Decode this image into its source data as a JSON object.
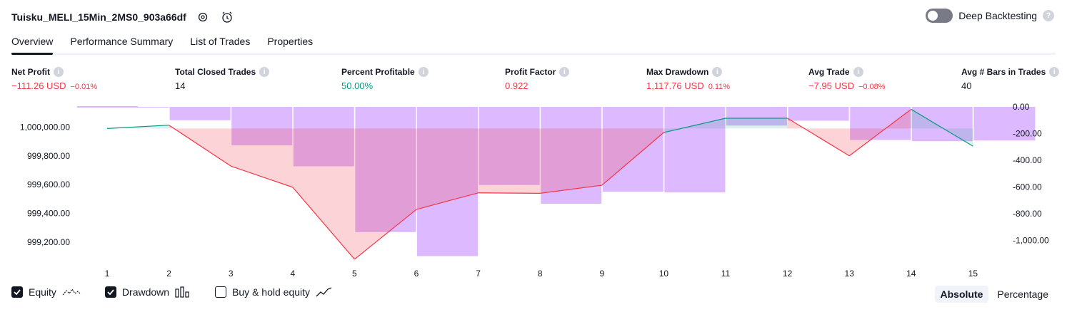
{
  "header": {
    "title": "Tuisku_MELI_15Min_2MS0_903a66df",
    "deep_backtesting_label": "Deep Backtesting"
  },
  "tabs": [
    {
      "label": "Overview",
      "active": true
    },
    {
      "label": "Performance Summary",
      "active": false
    },
    {
      "label": "List of Trades",
      "active": false
    },
    {
      "label": "Properties",
      "active": false
    }
  ],
  "metrics": {
    "net_profit": {
      "label": "Net Profit",
      "value": "−111.26 USD",
      "pct": "−0.01%"
    },
    "total_closed_trades": {
      "label": "Total Closed Trades",
      "value": "14"
    },
    "percent_profitable": {
      "label": "Percent Profitable",
      "value": "50.00%"
    },
    "profit_factor": {
      "label": "Profit Factor",
      "value": "0.922"
    },
    "max_drawdown": {
      "label": "Max Drawdown",
      "value": "1,117.76 USD",
      "pct": "0.11%"
    },
    "avg_trade": {
      "label": "Avg Trade",
      "value": "−7.95 USD",
      "pct": "−0.08%"
    },
    "avg_bars": {
      "label": "Avg # Bars in Trades",
      "value": "40"
    }
  },
  "chart_data": {
    "type": "line",
    "x": [
      1,
      2,
      3,
      4,
      5,
      6,
      7,
      8,
      9,
      10,
      11,
      12,
      13,
      14,
      15
    ],
    "left_axis_ticks": [
      "1,000,000.00",
      "999,800.00",
      "999,600.00",
      "999,400.00",
      "999,200.00"
    ],
    "left_axis_values": [
      1000000,
      999800,
      999600,
      999400,
      999200
    ],
    "right_axis_ticks": [
      "0.00",
      "-200.00",
      "-400.00",
      "-600.00",
      "-800.00",
      "-1,000.00"
    ],
    "right_axis_values": [
      0,
      -200,
      -400,
      -600,
      -800,
      -1000
    ],
    "left_ylim": [
      999092,
      1000140
    ],
    "right_ylim": [
      -1130,
      0
    ],
    "equity": [
      999990,
      1000013,
      999729,
      999582,
      999082,
      999428,
      999543,
      999540,
      999596,
      999962,
      1000061,
      1000061,
      999800,
      1000123,
      999867
    ],
    "drawdown": [
      -5,
      -100,
      -288,
      -445,
      -937,
      -1117,
      -585,
      -725,
      -635,
      -640,
      -140,
      -104,
      -248,
      -257,
      -252
    ],
    "colors": {
      "equity_up": "#089981",
      "equity_down": "#f23645",
      "drawdown": "#d9b3ff"
    },
    "legend": [
      {
        "label": "Equity",
        "checked": true
      },
      {
        "label": "Drawdown",
        "checked": true
      },
      {
        "label": "Buy & hold equity",
        "checked": false
      }
    ]
  },
  "mode_buttons": [
    {
      "label": "Absolute",
      "active": true
    },
    {
      "label": "Percentage",
      "active": false
    }
  ],
  "icons": [
    "settings-icon",
    "alert-clock-icon",
    "help-icon",
    "info-icon",
    "check-icon",
    "equity-line-icon",
    "bars-icon",
    "trend-line-icon"
  ]
}
